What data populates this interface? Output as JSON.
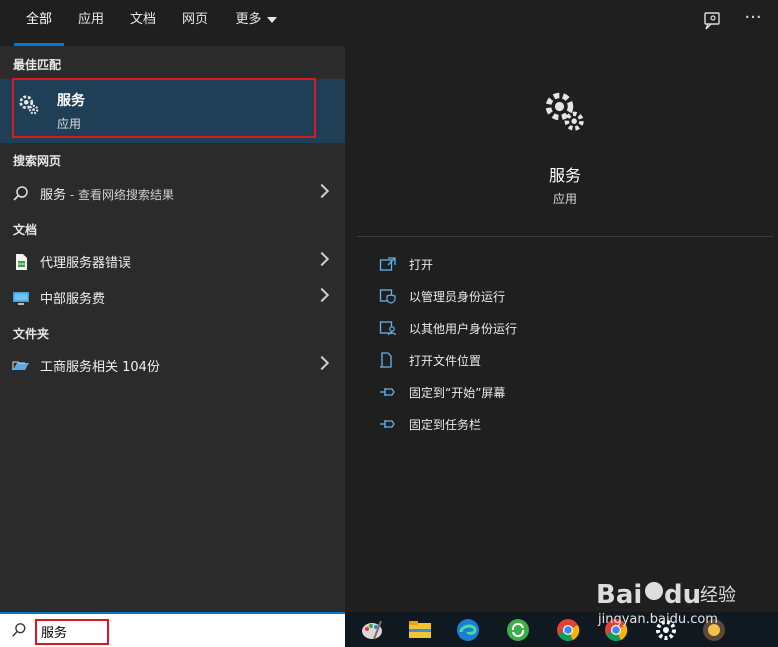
{
  "tabs": [
    {
      "label": "全部",
      "active": true
    },
    {
      "label": "应用"
    },
    {
      "label": "文档"
    },
    {
      "label": "网页"
    },
    {
      "label": "更多"
    }
  ],
  "top_icons": {
    "feedback": "feedback-icon",
    "more": "···"
  },
  "left": {
    "best_match_title": "最佳匹配",
    "best_match": {
      "title": "服务",
      "subtitle": "应用",
      "icon": "gear-icon"
    },
    "web_title": "搜索网页",
    "web_item": {
      "label": "服务",
      "sub": " - 查看网络搜索结果"
    },
    "docs_title": "文档",
    "docs": [
      {
        "label": "代理服务器错误",
        "icon": "spreadsheet-doc-icon"
      },
      {
        "label": "中部服务费",
        "icon": "monitor-icon"
      }
    ],
    "folders_title": "文件夹",
    "folders": [
      {
        "label": "工商服务相关 104份",
        "icon": "folder-icon"
      }
    ]
  },
  "detail": {
    "title": "服务",
    "subtitle": "应用",
    "actions": [
      {
        "label": "打开",
        "icon": "open-icon"
      },
      {
        "label": "以管理员身份运行",
        "icon": "shield-run-icon"
      },
      {
        "label": "以其他用户身份运行",
        "icon": "user-run-icon"
      },
      {
        "label": "打开文件位置",
        "icon": "file-location-icon"
      },
      {
        "label": "固定到“开始”屏幕",
        "icon": "pin-icon"
      },
      {
        "label": "固定到任务栏",
        "icon": "pin-icon"
      }
    ]
  },
  "search": {
    "value": "服务"
  },
  "watermark": {
    "text": "jingyan.baidu.com",
    "logo": "Baidu经验"
  },
  "colors": {
    "accent": "#0078d4",
    "highlight": "#d9181f",
    "selected": "#1e3f56"
  }
}
